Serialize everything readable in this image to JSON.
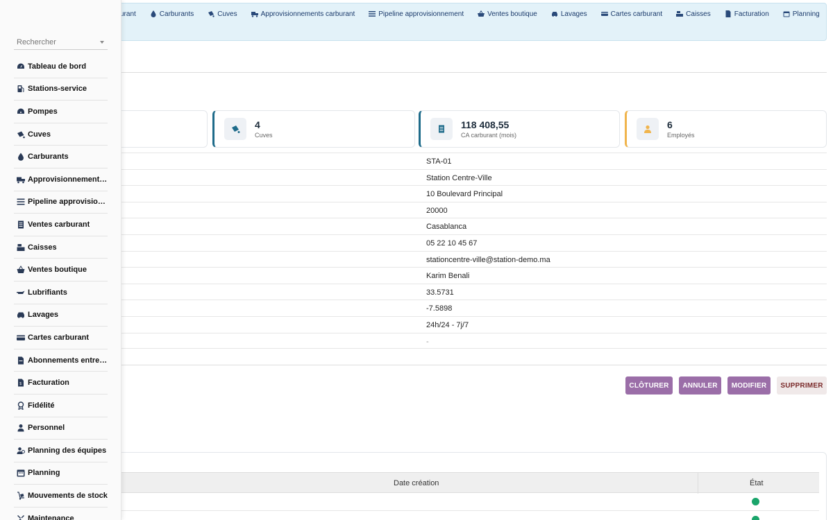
{
  "topnav": {
    "items": [
      {
        "label": "urant",
        "icon": "fuel-icon"
      },
      {
        "label": "Carburants",
        "icon": "drop-icon"
      },
      {
        "label": "Cuves",
        "icon": "bucket-icon"
      },
      {
        "label": "Approvisionnements carburant",
        "icon": "truck-icon"
      },
      {
        "label": "Pipeline approvisionnement",
        "icon": "list-icon"
      },
      {
        "label": "Ventes boutique",
        "icon": "basket-icon"
      },
      {
        "label": "Lavages",
        "icon": "car-icon"
      },
      {
        "label": "Cartes carburant",
        "icon": "card-icon"
      },
      {
        "label": "Caisses",
        "icon": "register-icon"
      },
      {
        "label": "Facturation",
        "icon": "invoice-icon"
      },
      {
        "label": "Planning",
        "icon": "calendar-icon"
      }
    ]
  },
  "stats": [
    {
      "value": "4",
      "label": "Cuves",
      "accent": "#1e6b8a",
      "icon": "bucket-icon"
    },
    {
      "value": "118 408,55",
      "label": "CA carburant (mois)",
      "accent": "#1e6b8a",
      "icon": "receipt-icon"
    },
    {
      "value": "6",
      "label": "Employés",
      "accent": "#f0b44c",
      "icon": "employee-icon"
    }
  ],
  "details": [
    "STA-01",
    "Station Centre-Ville",
    "10 Boulevard Principal",
    "20000",
    "Casablanca",
    "05 22 10 45 67",
    "stationcentre-ville@station-demo.ma",
    "Karim Benali",
    "33.5731",
    "-7.5898",
    "24h/24 - 7j/7",
    "-"
  ],
  "actions": {
    "close": "CLÔTURER",
    "cancel": "ANNULER",
    "edit": "MODIFIER",
    "delete": "SUPPRIMER"
  },
  "table": {
    "col_date": "Date création",
    "col_state": "État",
    "status_color": "#1aa56b"
  },
  "sidebar": {
    "search_placeholder": "Rechercher",
    "items": [
      {
        "label": "Tableau de bord",
        "icon": "dashboard-icon"
      },
      {
        "label": "Stations-service",
        "icon": "fuel-pump-icon"
      },
      {
        "label": "Pompes",
        "icon": "gauge-icon"
      },
      {
        "label": "Cuves",
        "icon": "bucket-icon"
      },
      {
        "label": "Carburants",
        "icon": "drop-icon"
      },
      {
        "label": "Approvisionnements carburant",
        "icon": "truck-icon"
      },
      {
        "label": "Pipeline approvisionnement",
        "icon": "list-icon"
      },
      {
        "label": "Ventes carburant",
        "icon": "receipt-icon"
      },
      {
        "label": "Caisses",
        "icon": "register-icon"
      },
      {
        "label": "Ventes boutique",
        "icon": "basket-icon"
      },
      {
        "label": "Lubrifiants",
        "icon": "oil-can-icon"
      },
      {
        "label": "Lavages",
        "icon": "car-icon"
      },
      {
        "label": "Cartes carburant",
        "icon": "card-icon"
      },
      {
        "label": "Abonnements entreprise",
        "icon": "contract-icon"
      },
      {
        "label": "Facturation",
        "icon": "invoice-icon"
      },
      {
        "label": "Fidélité",
        "icon": "award-icon"
      },
      {
        "label": "Personnel",
        "icon": "employee-icon"
      },
      {
        "label": "Planning des équipes",
        "icon": "team-icon"
      },
      {
        "label": "Planning",
        "icon": "calendar-icon"
      },
      {
        "label": "Mouvements de stock",
        "icon": "dolly-icon"
      },
      {
        "label": "Maintenance",
        "icon": "wrench-icon"
      }
    ]
  }
}
